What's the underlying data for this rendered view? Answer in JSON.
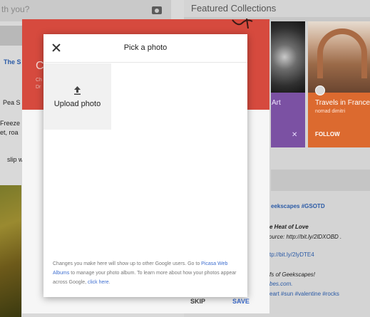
{
  "background": {
    "search_placeholder": "th you?",
    "featured_title": "Featured Collections",
    "left_link": "The S",
    "left_lines": [
      "Pea S",
      "Freeze",
      "et, roa",
      "slip w"
    ],
    "purple_card": {
      "label": "Art",
      "close": "✕"
    },
    "france_card": {
      "title": "Travels in France",
      "author": "nomad dimitri",
      "follow": "FOLLOW"
    },
    "right_lines": [
      {
        "text": "eekscapes #GSOTD",
        "style": "link"
      },
      {
        "text": "e Heat of Love",
        "style": "italic-bold"
      },
      {
        "text": "ource: http://bit.ly/2lDXOBD .",
        "style": "italic"
      },
      {
        "text": "tp://bit.ly/2lyDTE4",
        "style": "link-plain"
      },
      {
        "text": "fs of Geekscapes!",
        "style": "italic"
      },
      {
        "text": "bes.com.",
        "style": "link-plain"
      },
      {
        "text": "eart #sun #valentine #rocks",
        "style": "link-plain"
      }
    ]
  },
  "middle_dialog": {
    "header_letter": "C",
    "sub1": "Ch",
    "sub2": "Dr",
    "skip_label": "SKIP",
    "save_label": "SAVE"
  },
  "picker": {
    "title": "Pick a photo",
    "upload_label": "Upload photo",
    "footer": {
      "text_before": "Changes you make here will show up to other Google users. Go to ",
      "link1": "Picasa Web Albums",
      "text_middle": " to manage your photo album. To learn more about how your photos appear across Google, ",
      "link2": "click here",
      "text_after": "."
    }
  },
  "colors": {
    "header_red": "#d64a3e",
    "purple": "#7b51a3",
    "orange": "#dc6a2f",
    "link_blue": "#3f6fd0"
  }
}
